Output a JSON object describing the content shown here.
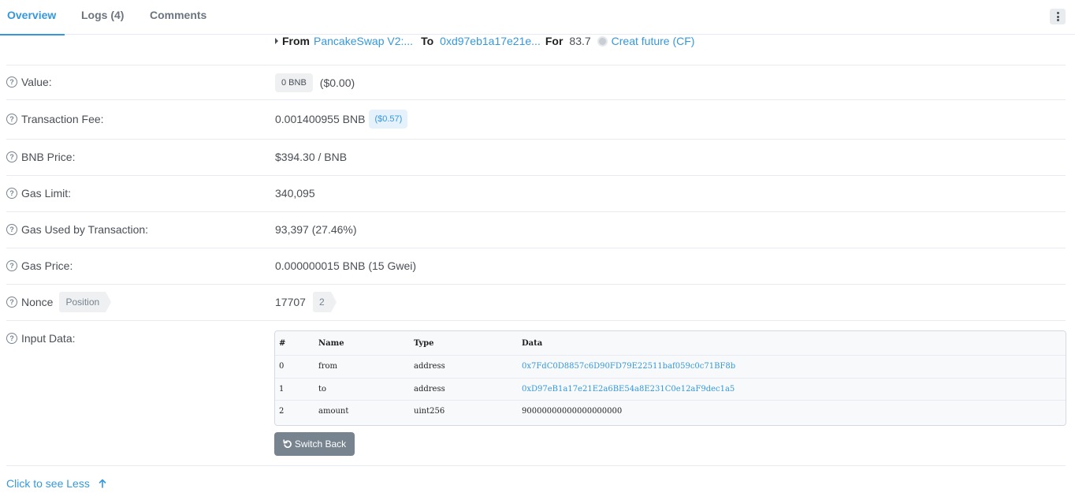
{
  "tabs": [
    {
      "label": "Overview",
      "active": true
    },
    {
      "label": "Logs (4)",
      "active": false
    },
    {
      "label": "Comments",
      "active": false
    }
  ],
  "transfer": {
    "from_label": "From",
    "from_value": "PancakeSwap V2:...",
    "to_label": "To",
    "to_value": "0xd97eb1a17e21e...",
    "for_label": "For",
    "amount": "83.7",
    "token": "Creat future (CF)"
  },
  "rows": {
    "value": {
      "label": "Value:",
      "amount": "0 BNB",
      "usd": "($0.00)"
    },
    "fee": {
      "label": "Transaction Fee:",
      "amount": "0.001400955 BNB",
      "usd": "($0.57)"
    },
    "price": {
      "label": "BNB Price:",
      "value": "$394.30 / BNB"
    },
    "gas_limit": {
      "label": "Gas Limit:",
      "value": "340,095"
    },
    "gas_used": {
      "label": "Gas Used by Transaction:",
      "value": "93,397 (27.46%)"
    },
    "gas_price": {
      "label": "Gas Price:",
      "value": "0.000000015 BNB (15 Gwei)"
    },
    "nonce": {
      "label": "Nonce",
      "tag": "Position",
      "value": "17707",
      "position": "2"
    },
    "input": {
      "label": "Input Data:"
    }
  },
  "input_table": {
    "headers": [
      "#",
      "Name",
      "Type",
      "Data"
    ],
    "rows": [
      {
        "idx": "0",
        "name": "from",
        "type": "address",
        "data": "0x7FdC0D8857c6D90FD79E22511baf059c0c71BF8b"
      },
      {
        "idx": "1",
        "name": "to",
        "type": "address",
        "data": "0xD97eB1a17e21E2a6BE54a8E231C0e12aF9dec1a5"
      },
      {
        "idx": "2",
        "name": "amount",
        "type": "uint256",
        "data": "90000000000000000000"
      }
    ]
  },
  "switch_back_label": "Switch Back",
  "see_less_label": "Click to see Less",
  "colors": {
    "accent": "#3498db",
    "text": "#4a4f55",
    "border": "#e7eaf3"
  }
}
